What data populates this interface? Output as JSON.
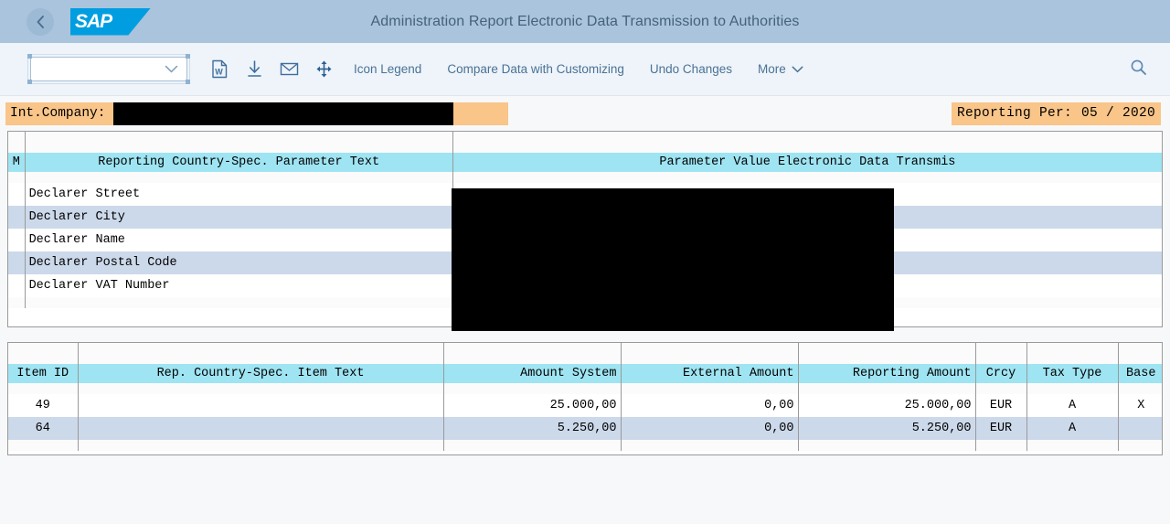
{
  "shellbar": {
    "back_icon": "chevron-left-icon",
    "logo_text": "SAP",
    "title": "Administration Report Electronic Data Transmission to Authorities"
  },
  "toolbar": {
    "variant_select": {
      "value": "",
      "placeholder": ""
    },
    "icons": [
      {
        "name": "word-export-icon",
        "glyph": "W"
      },
      {
        "name": "download-icon",
        "glyph": "download"
      },
      {
        "name": "email-icon",
        "glyph": "envelope"
      },
      {
        "name": "expand-collapse-icon",
        "glyph": "four-arrows"
      }
    ],
    "buttons": [
      {
        "name": "icon-legend-button",
        "label": "Icon Legend"
      },
      {
        "name": "compare-data-button",
        "label": "Compare Data with Customizing"
      },
      {
        "name": "undo-changes-button",
        "label": "Undo Changes"
      }
    ],
    "more_label": "More",
    "search_icon": "search-icon"
  },
  "filterbar": {
    "int_company_label": "Int.Company:",
    "int_company_value": "",
    "reporting_period_label": "Reporting Per:",
    "reporting_period_value": "05 / 2020"
  },
  "table1": {
    "columns": [
      {
        "key": "m",
        "label": "M",
        "align": "left"
      },
      {
        "key": "text",
        "label": "Reporting Country-Spec. Parameter Text",
        "align": "left"
      },
      {
        "key": "value",
        "label": "Parameter Value Electronic Data Transmis",
        "align": "left"
      }
    ],
    "rows": [
      {
        "m": "",
        "text": "Declarer Street",
        "value": ""
      },
      {
        "m": "",
        "text": "Declarer City",
        "value": ""
      },
      {
        "m": "",
        "text": "Declarer Name",
        "value": ""
      },
      {
        "m": "",
        "text": "Declarer Postal Code",
        "value": ""
      },
      {
        "m": "",
        "text": "Declarer VAT Number",
        "value": ""
      }
    ]
  },
  "table2": {
    "columns": [
      {
        "key": "item_id",
        "label": "Item ID",
        "align": "left"
      },
      {
        "key": "item_text",
        "label": "Rep. Country-Spec. Item Text",
        "align": "left"
      },
      {
        "key": "amount_system",
        "label": "Amount System",
        "align": "right"
      },
      {
        "key": "external_amount",
        "label": "External Amount",
        "align": "right"
      },
      {
        "key": "reporting_amount",
        "label": "Reporting Amount",
        "align": "right"
      },
      {
        "key": "currency",
        "label": "Crcy",
        "align": "center"
      },
      {
        "key": "tax_type",
        "label": "Tax Type",
        "align": "center"
      },
      {
        "key": "base",
        "label": "Base",
        "align": "center"
      }
    ],
    "rows": [
      {
        "item_id": "49",
        "item_text": "",
        "amount_system": "25.000,00",
        "external_amount": "0,00",
        "reporting_amount": "25.000,00",
        "currency": "EUR",
        "tax_type": "A",
        "base": "X"
      },
      {
        "item_id": "64",
        "item_text": "",
        "amount_system": "5.250,00",
        "external_amount": "0,00",
        "reporting_amount": "5.250,00",
        "currency": "EUR",
        "tax_type": "A",
        "base": ""
      }
    ]
  },
  "colors": {
    "shell_bg": "#a9c4dc",
    "toolbar_bg": "#eef4f9",
    "header_cell": "#9fe4f2",
    "alt_row": "#ccd9ea",
    "highlight_orange": "#f9c589",
    "brand_blue": "#009ee0",
    "redaction": "#000000"
  }
}
